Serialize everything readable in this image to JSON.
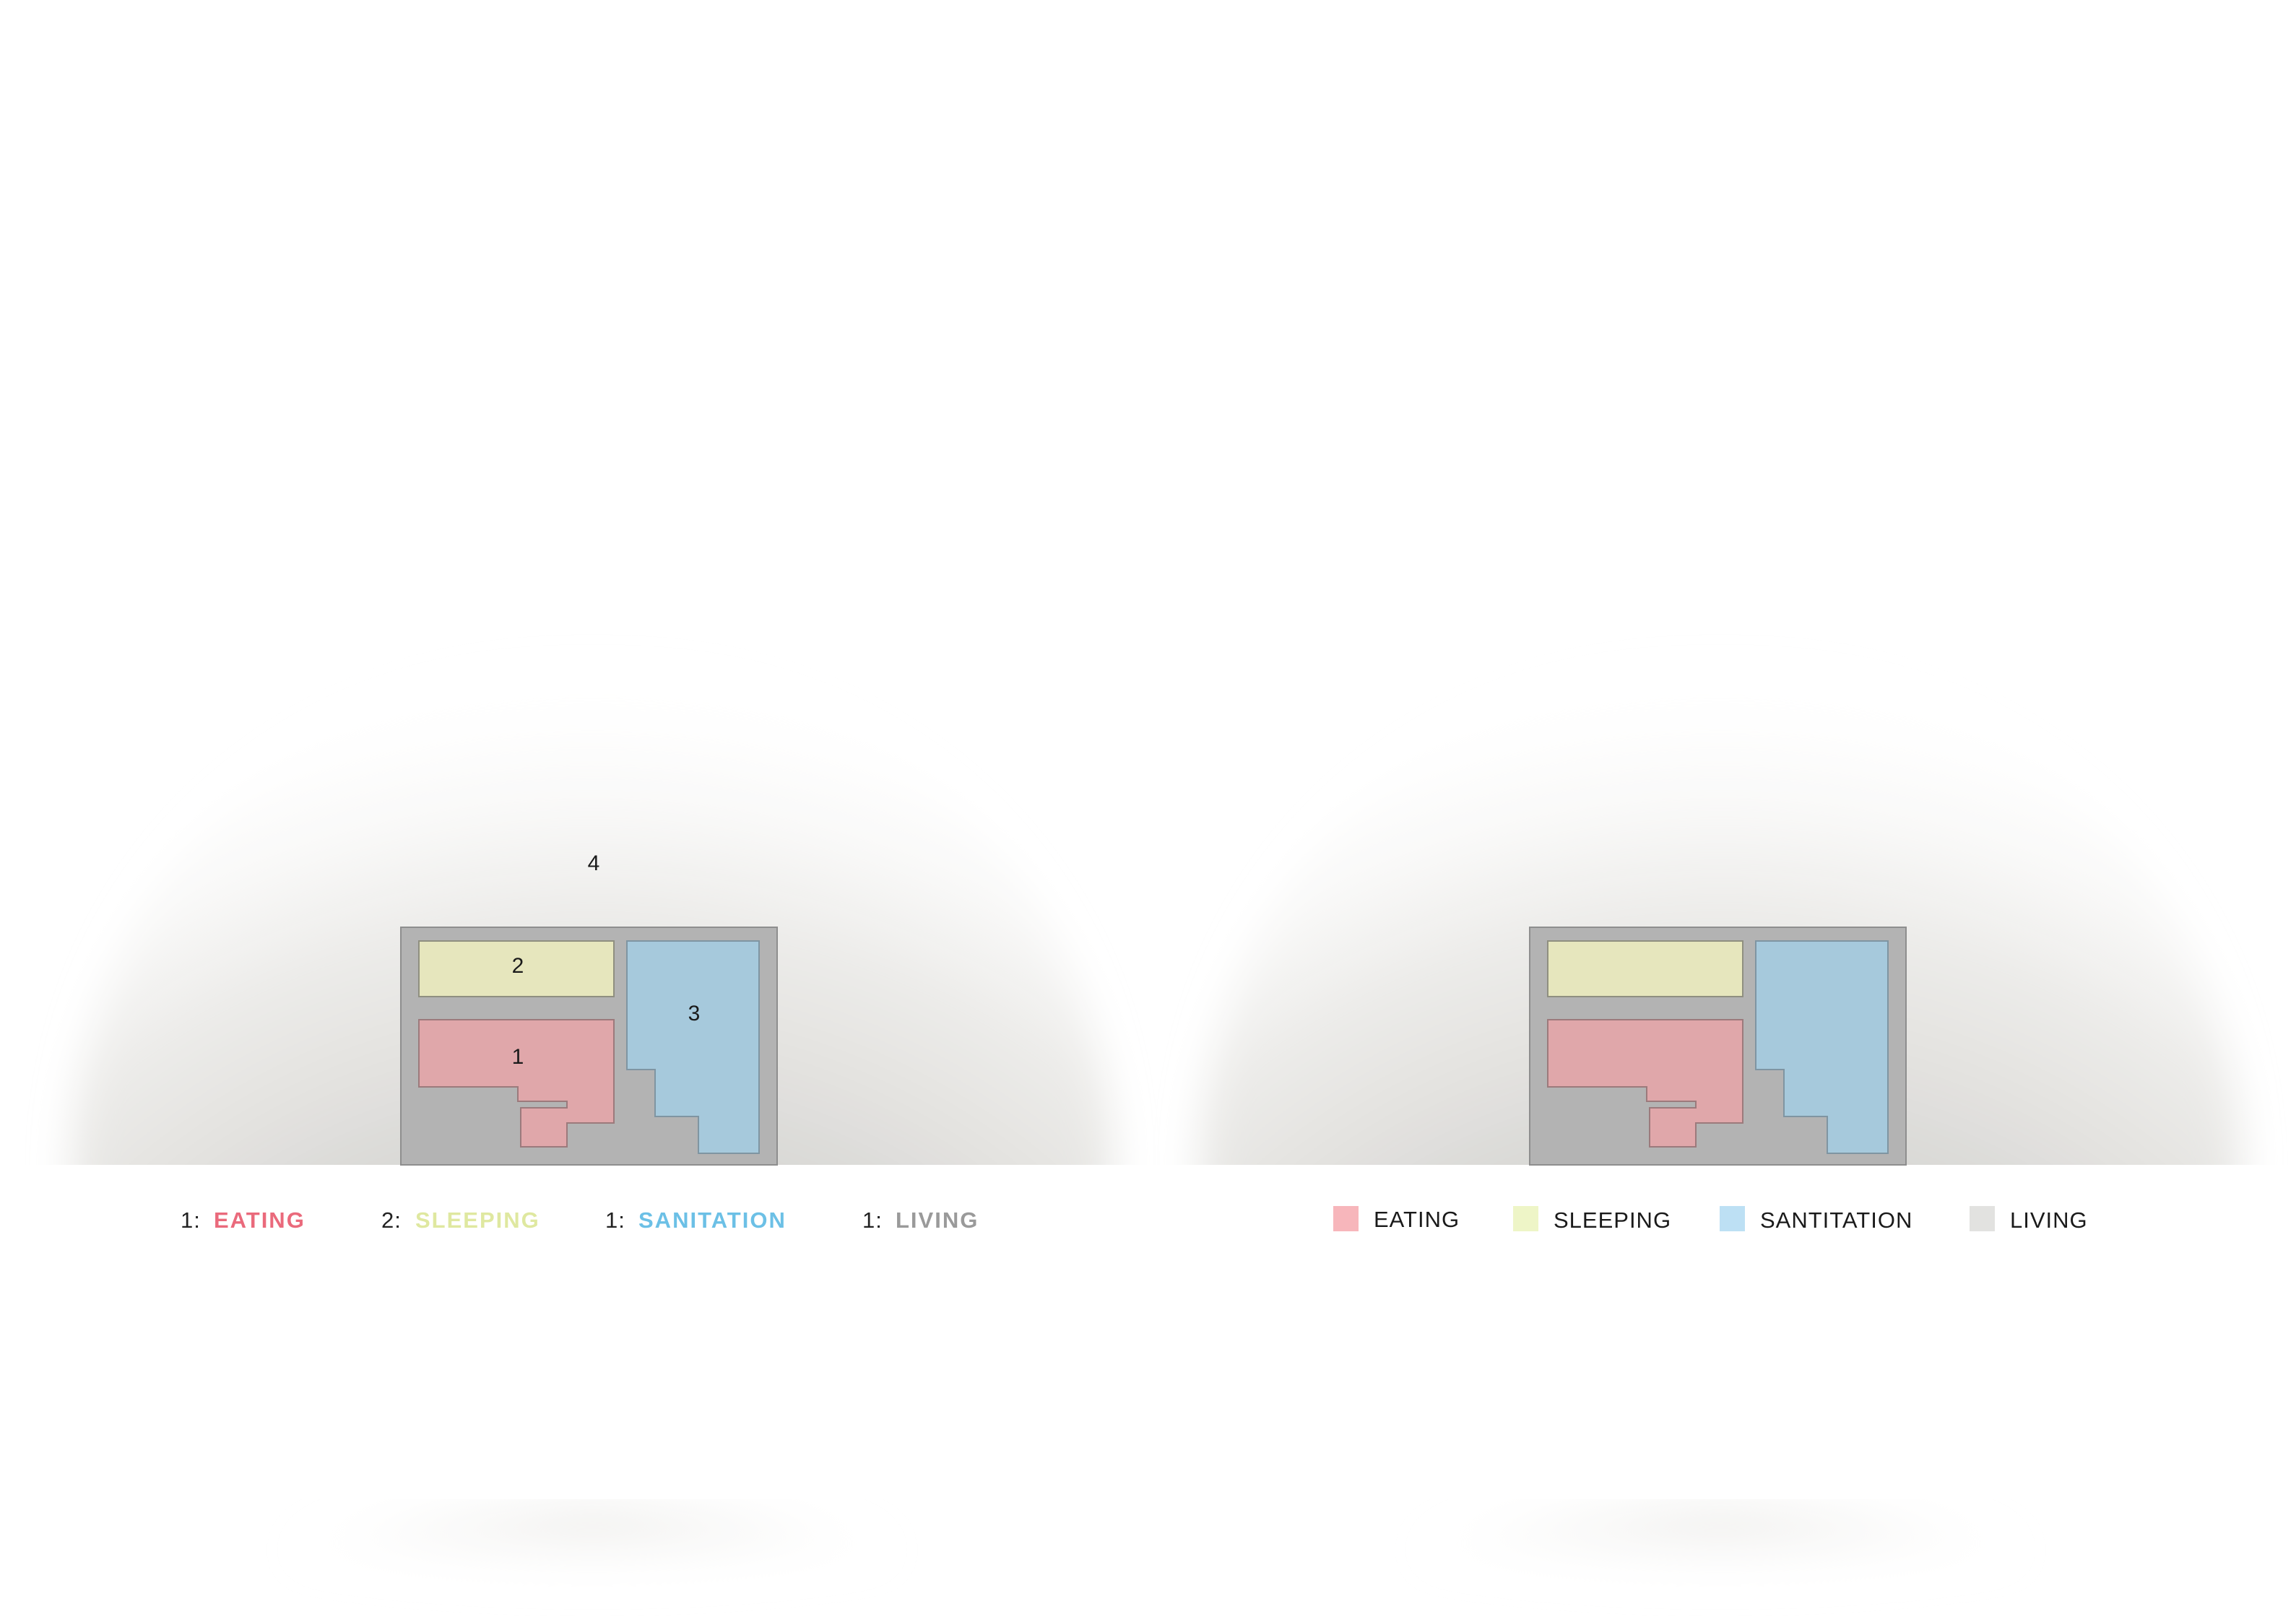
{
  "colors": {
    "eating": "#e0a7aa",
    "sleeping": "#e6e6bd",
    "sanitation": "#a6c9dc",
    "living": "#b3b3b3",
    "eating_text": "#ea6a7c",
    "sleeping_text": "#dfe8a0",
    "sanitation_text": "#6cc0e6",
    "living_text": "#9a9a9a",
    "eating_swatch": "#f7b6bb",
    "sleeping_swatch": "#eef5c7",
    "sanitation_swatch": "#bde0f4",
    "living_swatch": "#e2e2e0"
  },
  "left_diagram": {
    "labels": {
      "living": "4",
      "sleeping": "2",
      "sanitation": "3",
      "eating": "1"
    },
    "legend": [
      {
        "count": "1:",
        "name": "EATING"
      },
      {
        "count": "2:",
        "name": "SLEEPING"
      },
      {
        "count": "1:",
        "name": "SANITATION"
      },
      {
        "count": "1:",
        "name": "LIVING"
      }
    ]
  },
  "right_diagram": {
    "legend": [
      {
        "name": "EATING"
      },
      {
        "name": "SLEEPING"
      },
      {
        "name": "SANTITATION"
      },
      {
        "name": "LIVING"
      }
    ]
  }
}
